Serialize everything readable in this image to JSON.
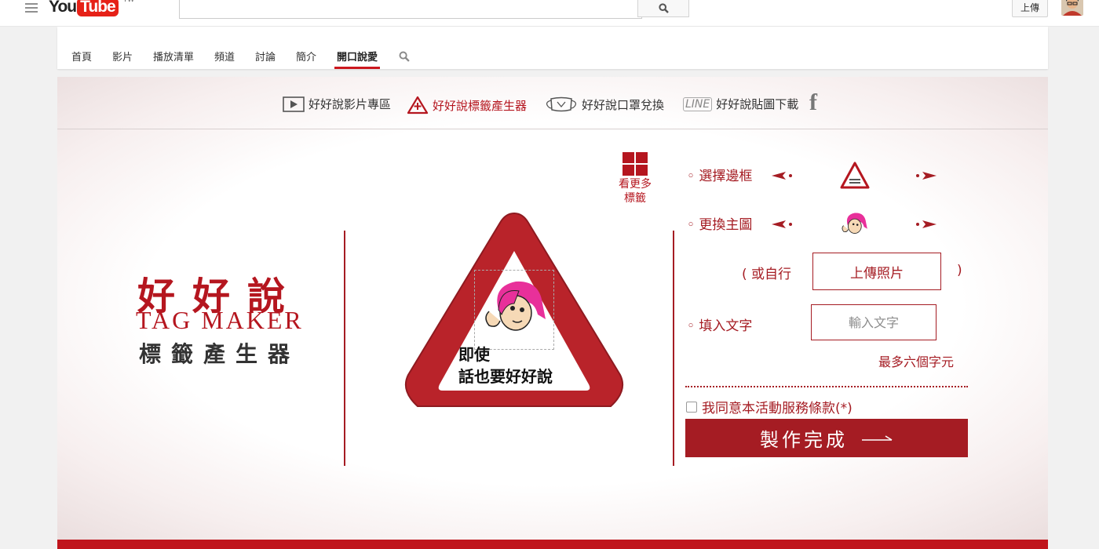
{
  "masthead": {
    "logo_you": "You",
    "logo_tube": "Tube",
    "logo_region": "TW",
    "search_placeholder": "",
    "upload_label": "上傳"
  },
  "channel_nav": {
    "tabs": [
      {
        "label": "首頁",
        "active": false
      },
      {
        "label": "影片",
        "active": false
      },
      {
        "label": "播放清單",
        "active": false
      },
      {
        "label": "頻道",
        "active": false
      },
      {
        "label": "討論",
        "active": false
      },
      {
        "label": "簡介",
        "active": false
      },
      {
        "label": "開口說愛",
        "active": true
      }
    ]
  },
  "banner_nav": {
    "items": [
      {
        "label": "好好說影片專區",
        "icon": "play-icon",
        "active": false
      },
      {
        "label": "好好說標籤產生器",
        "icon": "tag-plus-icon",
        "active": true
      },
      {
        "label": "好好說口罩兌換",
        "icon": "mask-icon",
        "active": false
      },
      {
        "label": "好好說貼圖下載",
        "icon": "line-icon",
        "icon_text": "LINE",
        "active": false
      }
    ],
    "facebook": "f"
  },
  "brand": {
    "title_cn": "好好說",
    "title_en": "TAG MAKER",
    "subtitle": "標籤產生器"
  },
  "more_tags": {
    "line1": "看更多",
    "line2": "標籤"
  },
  "tag_preview": {
    "line1": "即使",
    "line2": "話也要好好說"
  },
  "options": {
    "frame_label": "◦ 選擇邊框",
    "image_label": "◦ 更換主圖",
    "or_self": "(  或自行",
    "close_paren": ")",
    "upload_photo": "上傳照片",
    "text_label": "◦ 填入文字",
    "text_placeholder": "輸入文字",
    "max_chars": "最多六個字元",
    "agree_label": "我同意本活動服務條款(*)",
    "agree_checked": false,
    "make_button": "製作完成"
  },
  "colors": {
    "brand_red": "#a51c23",
    "accent_red": "#b5161f",
    "youtube_red": "#e62117"
  }
}
